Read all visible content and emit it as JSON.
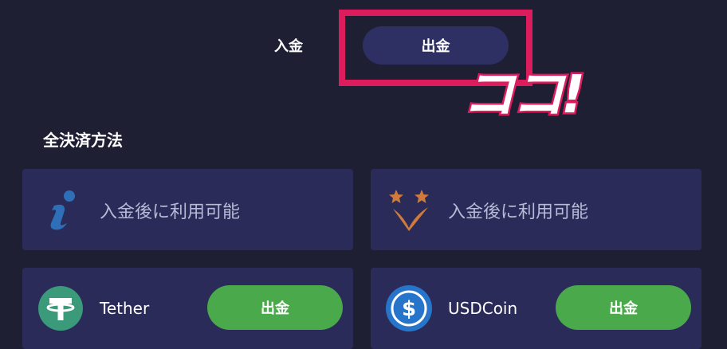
{
  "tabs": {
    "deposit_label": "入金",
    "withdraw_label": "出金"
  },
  "callout": {
    "text": "ココ!"
  },
  "section": {
    "title": "全決済方法"
  },
  "cards": [
    {
      "text": "入金後に利用可能",
      "icon": "info-icon"
    },
    {
      "text": "入金後に利用可能",
      "icon": "stars-check-icon"
    },
    {
      "name": "Tether",
      "button_label": "出金",
      "icon": "tether-icon"
    },
    {
      "name": "USDCoin",
      "button_label": "出金",
      "icon": "usdcoin-icon"
    }
  ],
  "colors": {
    "background": "#1e1f33",
    "card": "#2b2b5a",
    "active_tab": "#2e2f63",
    "highlight": "#dd1c5e",
    "button": "#4aa94a",
    "tether": "#3a9a7a",
    "usdc": "#2775ca"
  }
}
